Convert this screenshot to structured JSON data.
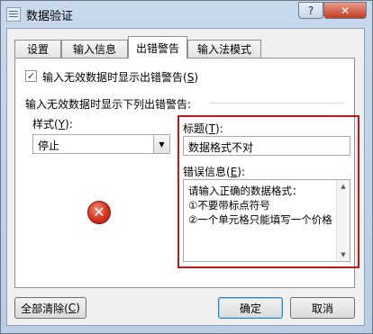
{
  "window": {
    "title": "数据验证",
    "help_label": "?",
    "close_label": "✕"
  },
  "tabs": [
    {
      "label": "设置",
      "active": false
    },
    {
      "label": "输入信息",
      "active": false
    },
    {
      "label": "出错警告",
      "active": true
    },
    {
      "label": "输入法模式",
      "active": false
    }
  ],
  "error_alert": {
    "show_alert_checkbox": {
      "checked": true,
      "check_mark": "✓",
      "label_prefix": "输入无效数据时显示出错警告(",
      "accel": "S",
      "label_suffix": ")"
    },
    "group_label": "输入无效数据时显示下列出错警告:",
    "style_label_prefix": "样式(",
    "style_accel": "Y",
    "style_label_suffix": "):",
    "style_value": "停止",
    "dropdown_arrow": "▼",
    "error_icon_glyph": "✕",
    "title_label_prefix": "标题(",
    "title_accel": "T",
    "title_label_suffix": "):",
    "title_value": "数据格式不对",
    "message_label_prefix": "错误信息(",
    "message_accel": "E",
    "message_label_suffix": "):",
    "message_value": "请输入正确的数据格式：\n①不要带标点符号\n②一个单元格只能填写一个价格",
    "scroll_up": "▲",
    "scroll_down": "▼"
  },
  "buttons": {
    "clear_all_prefix": "全部清除(",
    "clear_all_accel": "C",
    "clear_all_suffix": ")",
    "ok": "确定",
    "cancel": "取消"
  },
  "colors": {
    "highlight_border": "#c0161f",
    "error_icon": "#d3321c",
    "close_button": "#c33d24"
  }
}
